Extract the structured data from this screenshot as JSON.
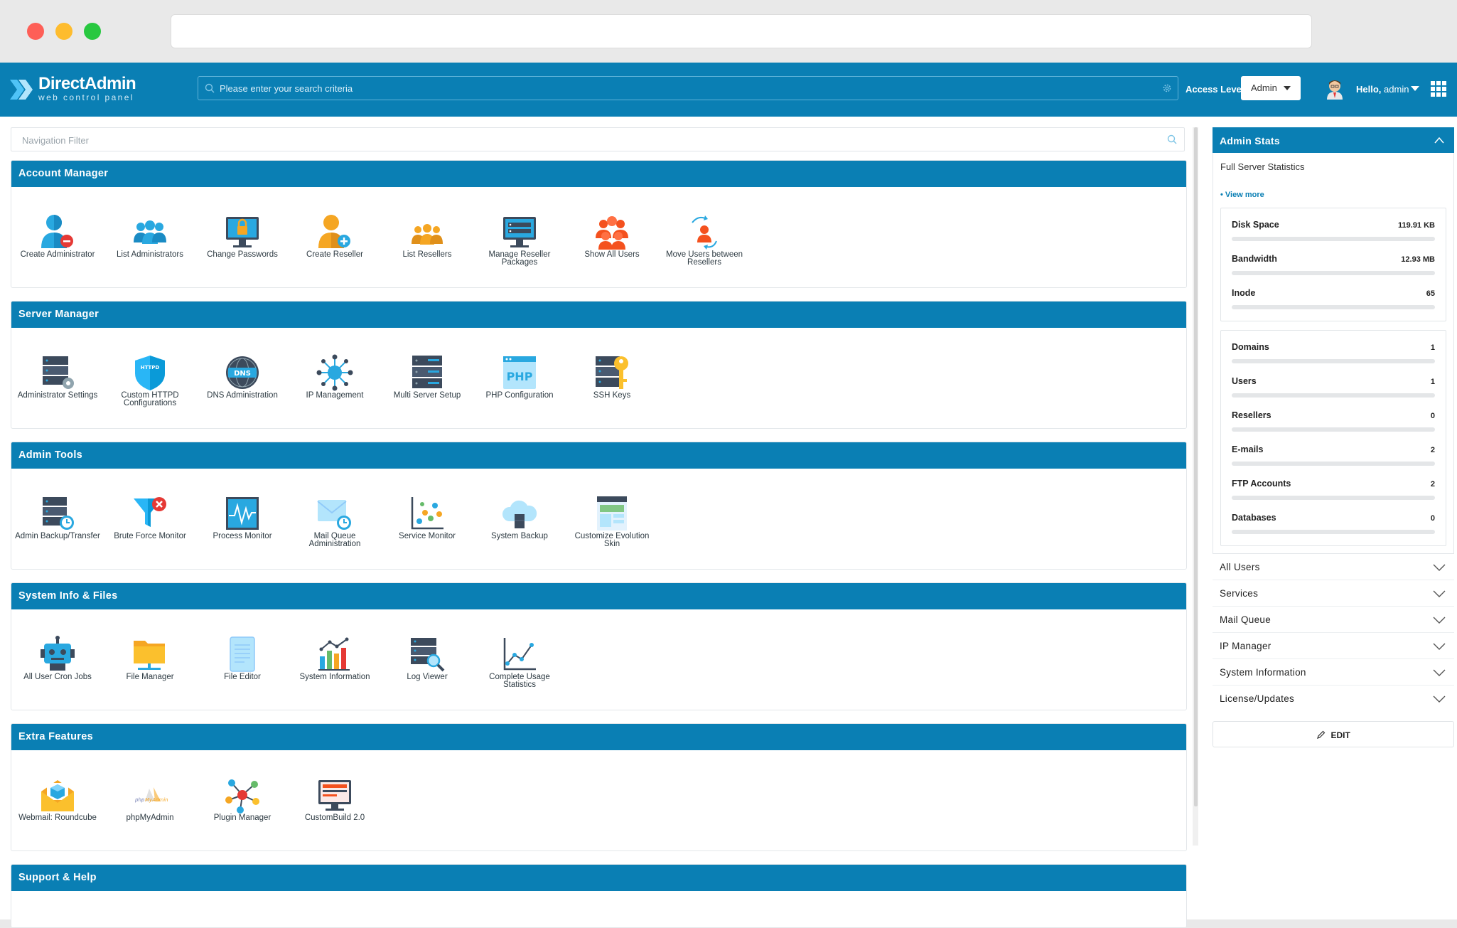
{
  "browser": {
    "url": ""
  },
  "header": {
    "logo_title": "DirectAdmin",
    "logo_subtitle": "web control panel",
    "search_placeholder": "Please enter your search criteria",
    "access_level_label": "Access Level",
    "access_level_value": "Admin",
    "greeting": "Hello,",
    "username": "admin"
  },
  "nav_filter_placeholder": "Navigation Filter",
  "sections": [
    {
      "title": "Account Manager",
      "items": [
        {
          "label": "Create Administrator",
          "icon": "create-admin-icon"
        },
        {
          "label": "List Administrators",
          "icon": "list-admins-icon"
        },
        {
          "label": "Change Passwords",
          "icon": "change-passwords-icon"
        },
        {
          "label": "Create Reseller",
          "icon": "create-reseller-icon"
        },
        {
          "label": "List Resellers",
          "icon": "list-resellers-icon"
        },
        {
          "label": "Manage Reseller Packages",
          "icon": "reseller-packages-icon"
        },
        {
          "label": "Show All Users",
          "icon": "all-users-icon"
        },
        {
          "label": "Move Users between Resellers",
          "icon": "move-users-icon"
        }
      ]
    },
    {
      "title": "Server Manager",
      "items": [
        {
          "label": "Administrator Settings",
          "icon": "admin-settings-icon"
        },
        {
          "label": "Custom HTTPD Configurations",
          "icon": "httpd-icon"
        },
        {
          "label": "DNS Administration",
          "icon": "dns-icon"
        },
        {
          "label": "IP Management",
          "icon": "ip-icon"
        },
        {
          "label": "Multi Server Setup",
          "icon": "multi-server-icon"
        },
        {
          "label": "PHP Configuration",
          "icon": "php-icon"
        },
        {
          "label": "SSH Keys",
          "icon": "ssh-keys-icon"
        }
      ]
    },
    {
      "title": "Admin Tools",
      "items": [
        {
          "label": "Admin Backup/Transfer",
          "icon": "backup-transfer-icon"
        },
        {
          "label": "Brute Force Monitor",
          "icon": "brute-force-icon"
        },
        {
          "label": "Process Monitor",
          "icon": "process-monitor-icon"
        },
        {
          "label": "Mail Queue Administration",
          "icon": "mail-queue-icon"
        },
        {
          "label": "Service Monitor",
          "icon": "service-monitor-icon"
        },
        {
          "label": "System Backup",
          "icon": "system-backup-icon"
        },
        {
          "label": "Customize Evolution Skin",
          "icon": "customize-skin-icon"
        }
      ]
    },
    {
      "title": "System Info & Files",
      "items": [
        {
          "label": "All User Cron Jobs",
          "icon": "cron-jobs-icon"
        },
        {
          "label": "File Manager",
          "icon": "file-manager-icon"
        },
        {
          "label": "File Editor",
          "icon": "file-editor-icon"
        },
        {
          "label": "System Information",
          "icon": "system-info-icon"
        },
        {
          "label": "Log Viewer",
          "icon": "log-viewer-icon"
        },
        {
          "label": "Complete Usage Statistics",
          "icon": "usage-stats-icon"
        }
      ]
    },
    {
      "title": "Extra Features",
      "items": [
        {
          "label": "Webmail: Roundcube",
          "icon": "webmail-icon"
        },
        {
          "label": "phpMyAdmin",
          "icon": "phpmyadmin-icon"
        },
        {
          "label": "Plugin Manager",
          "icon": "plugin-manager-icon"
        },
        {
          "label": "CustomBuild 2.0",
          "icon": "custombuild-icon"
        }
      ]
    },
    {
      "title": "Support & Help",
      "items": []
    }
  ],
  "sidebar": {
    "stats_title": "Admin Stats",
    "full_stats_label": "Full Server Statistics",
    "view_more": "• View more",
    "usage": [
      {
        "name": "Disk Space",
        "value": "119.91 KB"
      },
      {
        "name": "Bandwidth",
        "value": "12.93 MB"
      },
      {
        "name": "Inode",
        "value": "65"
      }
    ],
    "counts": [
      {
        "name": "Domains",
        "value": "1"
      },
      {
        "name": "Users",
        "value": "1"
      },
      {
        "name": "Resellers",
        "value": "0"
      },
      {
        "name": "E-mails",
        "value": "2"
      },
      {
        "name": "FTP Accounts",
        "value": "2"
      },
      {
        "name": "Databases",
        "value": "0"
      }
    ],
    "panels": [
      "All Users",
      "Services",
      "Mail Queue",
      "IP Manager",
      "System Information",
      "License/Updates"
    ],
    "edit_label": "EDIT"
  },
  "colors": {
    "brand": "#0a7fb4",
    "accent_orange": "#f5a623",
    "accent_red": "#e53935"
  }
}
